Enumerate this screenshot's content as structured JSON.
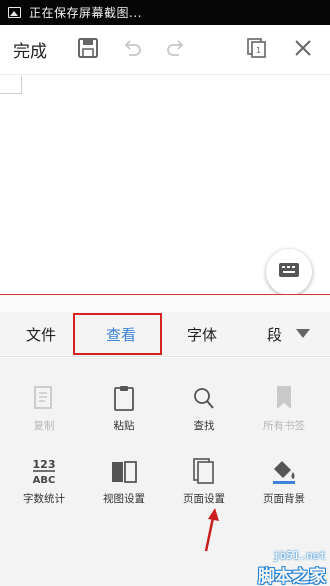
{
  "status_bar": {
    "text": "正在保存屏幕截图...",
    "icon": "image-icon"
  },
  "toolbar": {
    "done_label": "完成",
    "icons": [
      "save-icon",
      "undo-icon",
      "redo-icon",
      "pages-icon",
      "close-icon"
    ]
  },
  "document": {
    "keyboard_icon": "keyboard-icon"
  },
  "tabs": [
    {
      "label": "文件",
      "active": false
    },
    {
      "label": "查看",
      "active": true
    },
    {
      "label": "字体",
      "active": false
    },
    {
      "label": "段",
      "active": false
    }
  ],
  "tools": [
    {
      "label": "复制",
      "icon": "copy-icon",
      "enabled": false
    },
    {
      "label": "粘贴",
      "icon": "clipboard-icon",
      "enabled": true
    },
    {
      "label": "查找",
      "icon": "search-icon",
      "enabled": true
    },
    {
      "label": "所有书签",
      "icon": "bookmark-icon",
      "enabled": false
    },
    {
      "label": "字数统计",
      "icon": "word-count-icon",
      "icon_text_top": "123",
      "icon_text_bottom": "ABC",
      "enabled": true
    },
    {
      "label": "视图设置",
      "icon": "open-book-icon",
      "enabled": true
    },
    {
      "label": "页面设置",
      "icon": "page-setup-icon",
      "enabled": true
    },
    {
      "label": "页面背景",
      "icon": "paint-bucket-icon",
      "enabled": true
    }
  ],
  "colors": {
    "highlight_red": "#d42323",
    "active_tab": "#3b82d9",
    "status_bar": "#050505"
  },
  "watermark": {
    "url": "jb51.net",
    "name": "脚本之家"
  }
}
